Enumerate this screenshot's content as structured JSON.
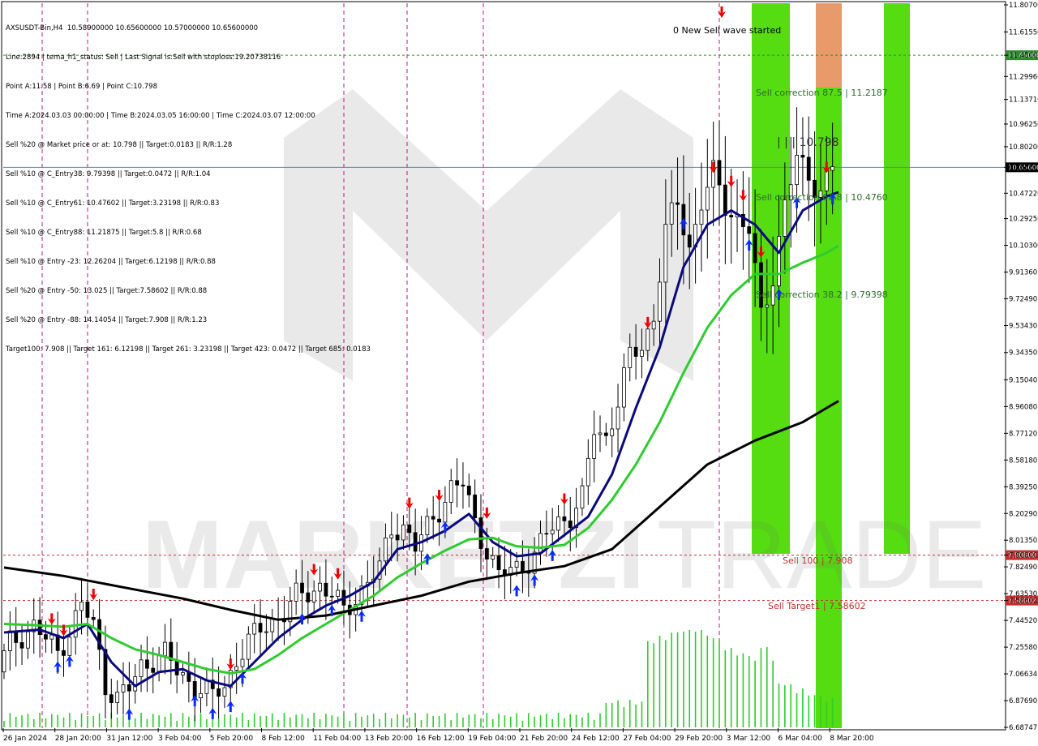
{
  "header": {
    "symbol_line": "AXSUSDT-Bin,H4  10.58900000 10.65600000 10.57000000 10.65600000",
    "lines": [
      "Line:2894 | tema_h1_status: Sell | Last Signal is:Sell with stoploss:19.20738116",
      "Point A:11.58 | Point B:6.69 | Point C:10.798",
      "Time A:2024.03.03 00:00:00 | Time B:2024.03.05 16:00:00 | Time C:2024.03.07 12:00:00",
      "Sell %20 @ Market price or at: 10.798 || Target:0.0183 || R/R:1.28",
      "Sell %10 @ C_Entry38: 9.79398 || Target:0.0472 || R/R:1.04",
      "Sell %10 @ C_Entry61: 10.47602 || Target:3.23198 || R/R:0.83",
      "Sell %10 @ C_Entry88: 11.21875 || Target:5.8 || R/R:0.68",
      "Sell %10 @ Entry -23: 12.26204 || Target:6.12198 || R/R:0.88",
      "Sell %20 @ Entry -50: 13.025 || Target:7.58602 || R/R:0.88",
      "Sell %20 @ Entry -88: 14.14054 || Target:7.908 || R/R:1.23",
      "Target100: 7.908 || Target 161: 6.12198 || Target 261: 3.23198 || Target 423: 0.0472 || Target 685: 0.0183"
    ]
  },
  "watermark": {
    "left": "MARKETZI",
    "right": "TRADE"
  },
  "annotations": {
    "wave_started": "0 New Sell wave started",
    "correction_875": "Sell correction 87.5 | 11.2187",
    "correction_618": "Sell correction 61.8 | 10.4760",
    "correction_382": "Sell correction 38.2 | 9.79398",
    "point_c": "| | | 10.798",
    "sell_100": "Sell 100 | 7.908",
    "sell_target1": "Sell Target1 | 7.58602"
  },
  "colors": {
    "bull_candle": "#000000",
    "bear_candle": "#000000",
    "ma_fast": "#0a0a80",
    "ma_mid": "#2ecc2e",
    "ma_slow": "#000000",
    "volume": "#2ecc2e",
    "zone_green": "#55dd11",
    "zone_orange": "#e89a6a",
    "level_green": "#2e8b2e",
    "level_red": "#c03030",
    "current_price_bg": "#000000",
    "vline": "#cc1177",
    "arrow_sell": "#ee0000",
    "arrow_buy": "#0a2aff"
  },
  "chart_data": {
    "type": "candlestick",
    "title": "AXSUSDT-Bin,H4",
    "ylim": [
      6.68747,
      11.807
    ],
    "price_ticks": [
      "11.80700",
      "11.61550",
      "11.45000",
      "11.29960",
      "11.13710",
      "10.96250",
      "10.80200",
      "10.65600",
      "10.47220",
      "10.29250",
      "10.10300",
      "9.91360",
      "9.72490",
      "9.53430",
      "9.34350",
      "9.15040",
      "8.96080",
      "8.77120",
      "8.58180",
      "8.39250",
      "8.20290",
      "8.01350",
      "7.90800",
      "7.82490",
      "7.63530",
      "7.58602",
      "7.44520",
      "7.25580",
      "7.06634",
      "6.87690",
      "6.68747"
    ],
    "time_ticks": [
      "26 Jan 2024",
      "28 Jan 20:00",
      "31 Jan 12:00",
      "3 Feb 04:00",
      "5 Feb 20:00",
      "8 Feb 12:00",
      "11 Feb 04:00",
      "13 Feb 20:00",
      "16 Feb 12:00",
      "19 Feb 04:00",
      "21 Feb 20:00",
      "24 Feb 12:00",
      "27 Feb 04:00",
      "29 Feb 20:00",
      "3 Mar 12:00",
      "6 Mar 04:00",
      "8 Mar 20:00"
    ],
    "levels": [
      {
        "name": "resistance",
        "price": "11.45000",
        "color": "green"
      },
      {
        "name": "current",
        "price": "10.65600",
        "color": "black"
      },
      {
        "name": "sell_100",
        "price": "7.90800",
        "color": "red"
      },
      {
        "name": "sell_target1",
        "price": "7.58602",
        "color": "red"
      }
    ],
    "close_path": [
      [
        0,
        7.08
      ],
      [
        2,
        7.28
      ],
      [
        4,
        7.35
      ],
      [
        6,
        7.41
      ],
      [
        8,
        7.3
      ],
      [
        10,
        7.22
      ],
      [
        12,
        7.38
      ],
      [
        14,
        7.55
      ],
      [
        16,
        7.4
      ],
      [
        18,
        7.0
      ],
      [
        20,
        6.9
      ],
      [
        22,
        6.95
      ],
      [
        24,
        7.12
      ],
      [
        26,
        7.18
      ],
      [
        28,
        7.2
      ],
      [
        30,
        7.08
      ],
      [
        32,
        7.02
      ],
      [
        34,
        6.96
      ],
      [
        36,
        6.9
      ],
      [
        38,
        6.98
      ],
      [
        40,
        7.18
      ],
      [
        42,
        7.28
      ],
      [
        44,
        7.38
      ],
      [
        46,
        7.45
      ],
      [
        48,
        7.5
      ],
      [
        50,
        7.6
      ],
      [
        52,
        7.65
      ],
      [
        54,
        7.7
      ],
      [
        56,
        7.62
      ],
      [
        58,
        7.5
      ],
      [
        60,
        7.62
      ],
      [
        62,
        7.72
      ],
      [
        64,
        7.8
      ],
      [
        66,
        8.1
      ],
      [
        68,
        8.12
      ],
      [
        70,
        7.95
      ],
      [
        72,
        8.1
      ],
      [
        74,
        8.25
      ],
      [
        76,
        8.38
      ],
      [
        78,
        8.4
      ],
      [
        80,
        8.15
      ],
      [
        82,
        7.95
      ],
      [
        84,
        7.75
      ],
      [
        86,
        7.8
      ],
      [
        88,
        7.85
      ],
      [
        90,
        7.9
      ],
      [
        92,
        8.05
      ],
      [
        94,
        8.15
      ],
      [
        96,
        8.2
      ],
      [
        98,
        8.3
      ],
      [
        100,
        8.8
      ],
      [
        102,
        8.75
      ],
      [
        104,
        9.0
      ],
      [
        106,
        9.3
      ],
      [
        108,
        9.4
      ],
      [
        110,
        9.6
      ],
      [
        112,
        10.2
      ],
      [
        114,
        10.4
      ],
      [
        116,
        10.1
      ],
      [
        118,
        10.4
      ],
      [
        120,
        10.6
      ],
      [
        122,
        10.4
      ],
      [
        124,
        10.3
      ],
      [
        126,
        10.2
      ],
      [
        128,
        9.6
      ],
      [
        130,
        9.9
      ],
      [
        132,
        10.4
      ],
      [
        134,
        10.7
      ],
      [
        136,
        10.6
      ],
      [
        138,
        10.5
      ],
      [
        140,
        10.656
      ]
    ],
    "candle_count": 140,
    "volume": [
      [
        108,
        0.45
      ],
      [
        116,
        0.55
      ],
      [
        122,
        0.4
      ],
      [
        126,
        0.35
      ],
      [
        128,
        0.45
      ],
      [
        130,
        0.2
      ],
      [
        132,
        0.18
      ],
      [
        134,
        0.15
      ],
      [
        136,
        0.12
      ],
      [
        138,
        0.1
      ],
      [
        140,
        0.08
      ]
    ],
    "series": [
      {
        "name": "ma_fast",
        "values": [
          [
            0,
            7.36
          ],
          [
            6,
            7.38
          ],
          [
            10,
            7.32
          ],
          [
            14,
            7.42
          ],
          [
            18,
            7.15
          ],
          [
            22,
            6.98
          ],
          [
            26,
            7.08
          ],
          [
            30,
            7.1
          ],
          [
            34,
            7.02
          ],
          [
            38,
            6.98
          ],
          [
            42,
            7.15
          ],
          [
            46,
            7.32
          ],
          [
            50,
            7.45
          ],
          [
            54,
            7.55
          ],
          [
            58,
            7.62
          ],
          [
            62,
            7.72
          ],
          [
            66,
            7.95
          ],
          [
            70,
            8.0
          ],
          [
            74,
            8.08
          ],
          [
            78,
            8.2
          ],
          [
            82,
            8.0
          ],
          [
            86,
            7.9
          ],
          [
            90,
            7.92
          ],
          [
            94,
            8.05
          ],
          [
            98,
            8.18
          ],
          [
            102,
            8.48
          ],
          [
            106,
            8.95
          ],
          [
            110,
            9.38
          ],
          [
            114,
            9.95
          ],
          [
            118,
            10.25
          ],
          [
            122,
            10.35
          ],
          [
            126,
            10.25
          ],
          [
            130,
            10.05
          ],
          [
            134,
            10.35
          ],
          [
            138,
            10.45
          ],
          [
            140,
            10.48
          ]
        ]
      },
      {
        "name": "ma_mid",
        "values": [
          [
            0,
            7.42
          ],
          [
            6,
            7.41
          ],
          [
            10,
            7.4
          ],
          [
            14,
            7.42
          ],
          [
            18,
            7.32
          ],
          [
            22,
            7.24
          ],
          [
            26,
            7.2
          ],
          [
            30,
            7.15
          ],
          [
            34,
            7.1
          ],
          [
            38,
            7.07
          ],
          [
            42,
            7.1
          ],
          [
            46,
            7.2
          ],
          [
            50,
            7.32
          ],
          [
            54,
            7.42
          ],
          [
            58,
            7.52
          ],
          [
            62,
            7.62
          ],
          [
            66,
            7.75
          ],
          [
            70,
            7.85
          ],
          [
            74,
            7.94
          ],
          [
            78,
            8.02
          ],
          [
            82,
            8.03
          ],
          [
            86,
            7.97
          ],
          [
            90,
            7.96
          ],
          [
            94,
            7.98
          ],
          [
            98,
            8.1
          ],
          [
            102,
            8.3
          ],
          [
            106,
            8.55
          ],
          [
            110,
            8.85
          ],
          [
            114,
            9.2
          ],
          [
            118,
            9.52
          ],
          [
            122,
            9.75
          ],
          [
            126,
            9.9
          ],
          [
            130,
            9.9
          ],
          [
            134,
            9.98
          ],
          [
            138,
            10.05
          ],
          [
            140,
            10.1
          ]
        ]
      },
      {
        "name": "ma_slow",
        "values": [
          [
            0,
            7.82
          ],
          [
            10,
            7.76
          ],
          [
            20,
            7.68
          ],
          [
            30,
            7.6
          ],
          [
            38,
            7.52
          ],
          [
            46,
            7.45
          ],
          [
            54,
            7.48
          ],
          [
            62,
            7.55
          ],
          [
            70,
            7.62
          ],
          [
            78,
            7.72
          ],
          [
            86,
            7.78
          ],
          [
            94,
            7.83
          ],
          [
            102,
            7.95
          ],
          [
            110,
            8.25
          ],
          [
            118,
            8.55
          ],
          [
            126,
            8.72
          ],
          [
            134,
            8.85
          ],
          [
            140,
            9.0
          ]
        ]
      }
    ]
  }
}
